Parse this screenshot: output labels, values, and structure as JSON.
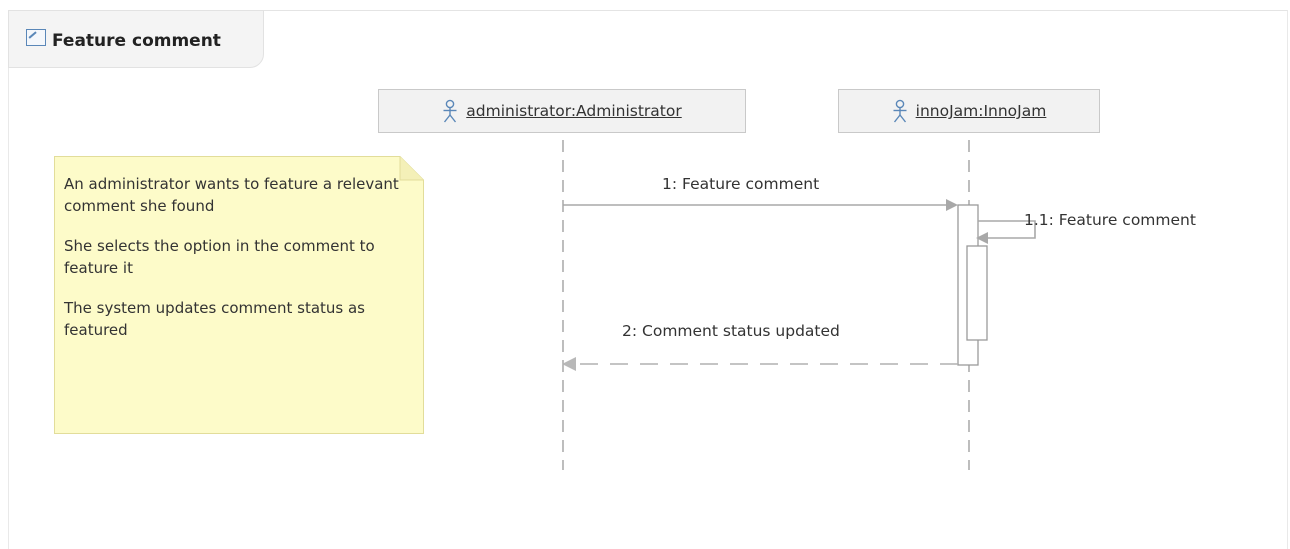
{
  "diagram": {
    "title": "Feature comment",
    "lifelines": [
      {
        "name": "administrator:Administrator"
      },
      {
        "name": "innoJam:InnoJam"
      }
    ],
    "note": {
      "paragraphs": [
        "An administrator wants to feature a relevant comment she found",
        "She selects the option in the comment to feature it",
        "The system updates comment status as featured"
      ]
    },
    "messages": [
      {
        "label": "1: Feature comment"
      },
      {
        "label": "1.1: Feature comment"
      },
      {
        "label": "2: Comment status updated"
      }
    ]
  }
}
